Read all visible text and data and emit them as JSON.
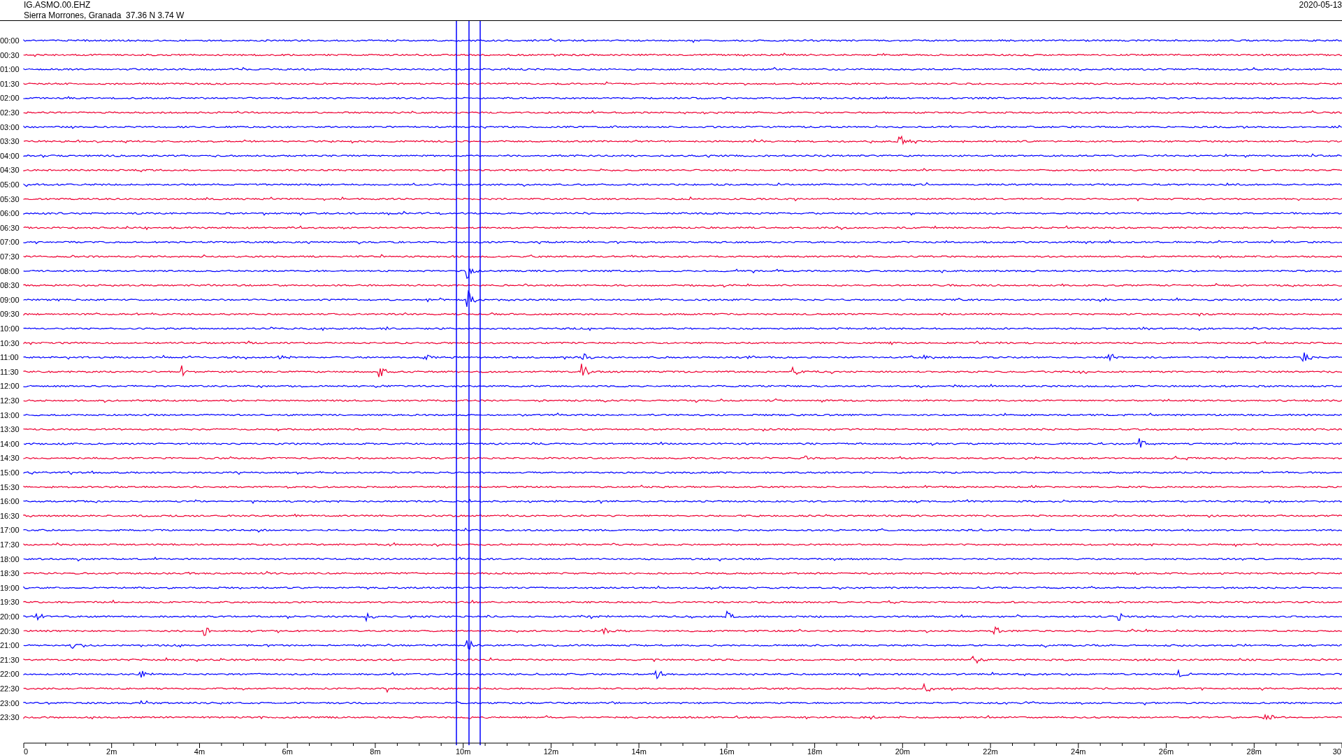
{
  "header": {
    "station": "IG.ASMO.00.EHZ",
    "location": "Sierra Morrones, Granada  37.36 N 3.74 W",
    "date": "2020-05-13"
  },
  "rows": [
    {
      "time": "00:00",
      "color": "#0000ff"
    },
    {
      "time": "00:30",
      "color": "#ee0033"
    },
    {
      "time": "01:00",
      "color": "#0000ff"
    },
    {
      "time": "01:30",
      "color": "#ee0033"
    },
    {
      "time": "02:00",
      "color": "#0000ff"
    },
    {
      "time": "02:30",
      "color": "#ee0033"
    },
    {
      "time": "03:00",
      "color": "#0000ff"
    },
    {
      "time": "03:30",
      "color": "#ee0033"
    },
    {
      "time": "04:00",
      "color": "#0000ff"
    },
    {
      "time": "04:30",
      "color": "#ee0033"
    },
    {
      "time": "05:00",
      "color": "#0000ff"
    },
    {
      "time": "05:30",
      "color": "#ee0033"
    },
    {
      "time": "06:00",
      "color": "#0000ff"
    },
    {
      "time": "06:30",
      "color": "#ee0033"
    },
    {
      "time": "07:00",
      "color": "#0000ff"
    },
    {
      "time": "07:30",
      "color": "#ee0033"
    },
    {
      "time": "08:00",
      "color": "#0000ff"
    },
    {
      "time": "08:30",
      "color": "#ee0033"
    },
    {
      "time": "09:00",
      "color": "#0000ff"
    },
    {
      "time": "09:30",
      "color": "#ee0033"
    },
    {
      "time": "10:00",
      "color": "#0000ff"
    },
    {
      "time": "10:30",
      "color": "#ee0033"
    },
    {
      "time": "11:00",
      "color": "#0000ff"
    },
    {
      "time": "11:30",
      "color": "#ee0033"
    },
    {
      "time": "12:00",
      "color": "#0000ff"
    },
    {
      "time": "12:30",
      "color": "#ee0033"
    },
    {
      "time": "13:00",
      "color": "#0000ff"
    },
    {
      "time": "13:30",
      "color": "#ee0033"
    },
    {
      "time": "14:00",
      "color": "#0000ff"
    },
    {
      "time": "14:30",
      "color": "#ee0033"
    },
    {
      "time": "15:00",
      "color": "#0000ff"
    },
    {
      "time": "15:30",
      "color": "#ee0033"
    },
    {
      "time": "16:00",
      "color": "#0000ff"
    },
    {
      "time": "16:30",
      "color": "#ee0033"
    },
    {
      "time": "17:00",
      "color": "#0000ff"
    },
    {
      "time": "17:30",
      "color": "#ee0033"
    },
    {
      "time": "18:00",
      "color": "#0000ff"
    },
    {
      "time": "18:30",
      "color": "#ee0033"
    },
    {
      "time": "19:00",
      "color": "#0000ff"
    },
    {
      "time": "19:30",
      "color": "#ee0033"
    },
    {
      "time": "20:00",
      "color": "#0000ff"
    },
    {
      "time": "20:30",
      "color": "#ee0033"
    },
    {
      "time": "21:00",
      "color": "#0000ff"
    },
    {
      "time": "21:30",
      "color": "#ee0033"
    },
    {
      "time": "22:00",
      "color": "#0000ff"
    },
    {
      "time": "22:30",
      "color": "#ee0033"
    },
    {
      "time": "23:00",
      "color": "#0000ff"
    },
    {
      "time": "23:30",
      "color": "#ee0033"
    }
  ],
  "x_axis": {
    "ticks": [
      "0",
      "2m",
      "4m",
      "6m",
      "8m",
      "10m",
      "12m",
      "14m",
      "16m",
      "18m",
      "20m",
      "22m",
      "24m",
      "26m",
      "28m",
      "30"
    ]
  }
}
